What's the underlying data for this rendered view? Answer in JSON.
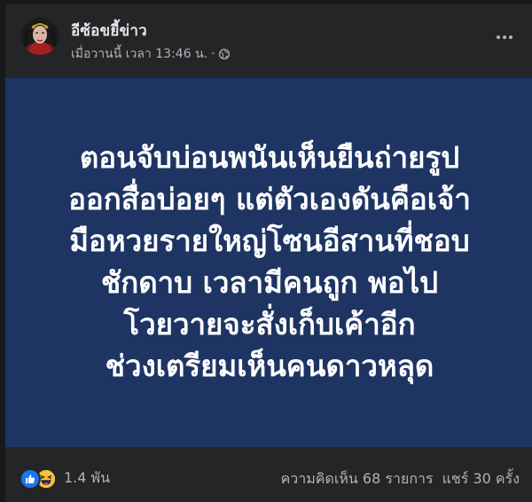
{
  "post": {
    "page_name": "อีซ้อขยี้ข่าว",
    "timestamp": "เมื่อวานนี้ เวลา 13:46 น.",
    "separator": "·",
    "privacy_icon": "globe-icon",
    "more_icon": "more-options-icon",
    "background_color": "#1e3463",
    "text_lines": [
      "ตอนจับบ่อนพนันเห็นยืนถ่ายรูป",
      "ออกสื่อบ่อยๆ แต่ตัวเองดันคือเจ้า",
      "มือหวยรายใหญ่โซนอีสานที่ชอบ",
      "ชักดาบ เวลามีคนถูก พอไป",
      "โวยวายจะสั่งเก็บเค้าอีก",
      "ช่วงเตรียมเห็นคนดาวหลุด"
    ]
  },
  "footer": {
    "reaction_icons": [
      "like-icon",
      "haha-icon"
    ],
    "reaction_count": "1.4 พัน",
    "comments": "ความคิดเห็น 68 รายการ",
    "shares": "แชร์ 30 ครั้ง"
  },
  "colors": {
    "card_bg": "#242526",
    "secondary_text": "#b0b3b8",
    "like_blue": "#1877f2",
    "haha_yellow": "#f7b125"
  }
}
